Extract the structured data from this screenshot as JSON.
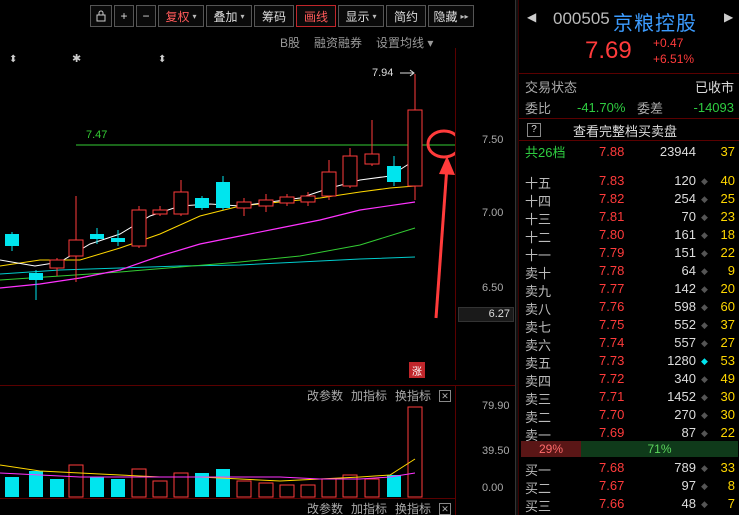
{
  "toolbar": {
    "items": [
      "复权",
      "叠加",
      "筹码",
      "画线",
      "显示",
      "简约",
      "隐藏"
    ]
  },
  "sub_menu": [
    "B股",
    "融资融券",
    "设置均线"
  ],
  "chart": {
    "price_axis": [
      "7.50",
      "7.00",
      "6.50"
    ],
    "current_price_tag": "6.27",
    "high_label": "7.94",
    "line_label": "7.47",
    "zhang_badge": "涨",
    "vol_axis": [
      "79.90",
      "39.50",
      "0.00"
    ],
    "ind_menu": [
      "改参数",
      "加指标",
      "换指标"
    ],
    "close_glyph": "✕",
    "colors": {
      "up": "#ff3b3b",
      "down": "#00e5ee",
      "ma5": "#ffffff",
      "ma10": "#ffd700",
      "ma20": "#ff33ff",
      "ma30": "#33cc33",
      "ma60": "#00cccc",
      "hline": "#33cc33",
      "annot": "#ff3b3b"
    }
  },
  "quote": {
    "code": "000505",
    "name": "京粮控股",
    "price": "7.69",
    "change": "+0.47",
    "change_pct": "+6.51%",
    "status_label": "交易状态",
    "status_value": "已收市",
    "weibi_label": "委比",
    "weibi_value": "-41.70%",
    "weicha_label": "委差",
    "weicha_value": "-14093",
    "full_book_icon": "?",
    "full_book_link": "查看完整档买卖盘",
    "total_label": "共26档",
    "total_price": "7.88",
    "total_vol": "23944",
    "total_cnt": "37"
  },
  "orderbook": [
    {
      "label": "十五",
      "price": "7.83",
      "vol": "120",
      "cnt": "40"
    },
    {
      "label": "十四",
      "price": "7.82",
      "vol": "254",
      "cnt": "25"
    },
    {
      "label": "十三",
      "price": "7.81",
      "vol": "70",
      "cnt": "23"
    },
    {
      "label": "十二",
      "price": "7.80",
      "vol": "161",
      "cnt": "18"
    },
    {
      "label": "十一",
      "price": "7.79",
      "vol": "151",
      "cnt": "22"
    },
    {
      "label": "卖十",
      "price": "7.78",
      "vol": "64",
      "cnt": "9"
    },
    {
      "label": "卖九",
      "price": "7.77",
      "vol": "142",
      "cnt": "20"
    },
    {
      "label": "卖八",
      "price": "7.76",
      "vol": "598",
      "cnt": "60"
    },
    {
      "label": "卖七",
      "price": "7.75",
      "vol": "552",
      "cnt": "37"
    },
    {
      "label": "卖六",
      "price": "7.74",
      "vol": "557",
      "cnt": "27"
    },
    {
      "label": "卖五",
      "price": "7.73",
      "vol": "1280",
      "cnt": "53"
    },
    {
      "label": "卖四",
      "price": "7.72",
      "vol": "340",
      "cnt": "49"
    },
    {
      "label": "卖三",
      "price": "7.71",
      "vol": "1452",
      "cnt": "30"
    },
    {
      "label": "卖二",
      "price": "7.70",
      "vol": "270",
      "cnt": "30"
    },
    {
      "label": "卖一",
      "price": "7.69",
      "vol": "87",
      "cnt": "22"
    }
  ],
  "ratio": {
    "left": "29%",
    "right": "71%"
  },
  "buys": [
    {
      "label": "买一",
      "price": "7.68",
      "vol": "789",
      "cnt": "33"
    },
    {
      "label": "买二",
      "price": "7.67",
      "vol": "97",
      "cnt": "8"
    },
    {
      "label": "买三",
      "price": "7.66",
      "vol": "48",
      "cnt": "7"
    }
  ]
}
